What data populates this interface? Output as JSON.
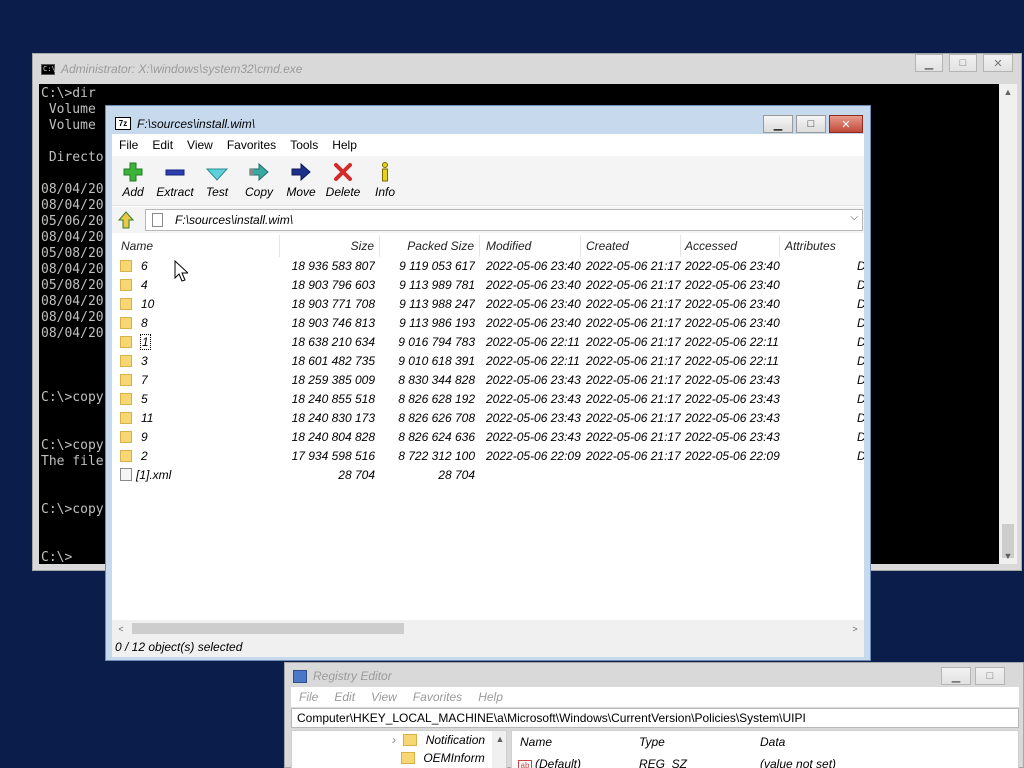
{
  "cmd": {
    "title": "Administrator: X:\\windows\\system32\\cmd.exe",
    "icon": "C:\\",
    "lines": [
      "C:\\>dir",
      " Volume",
      " Volume",
      "",
      " Directo",
      "",
      "08/04/20",
      "08/04/20",
      "05/06/20",
      "08/04/20",
      "05/08/20",
      "08/04/20",
      "05/08/20",
      "08/04/20",
      "08/04/20",
      "08/04/20",
      "",
      "",
      "",
      "C:\\>copy",
      "",
      "",
      "C:\\>copy",
      "The file",
      "",
      "",
      "C:\\>copy",
      "",
      "",
      "C:\\>"
    ]
  },
  "zip": {
    "title": "F:\\sources\\install.wim\\",
    "icon": "7z",
    "menu": [
      "File",
      "Edit",
      "View",
      "Favorites",
      "Tools",
      "Help"
    ],
    "toolbar": [
      {
        "label": "Add",
        "icon": "add-icon"
      },
      {
        "label": "Extract",
        "icon": "extract-icon"
      },
      {
        "label": "Test",
        "icon": "test-icon"
      },
      {
        "label": "Copy",
        "icon": "copy-icon"
      },
      {
        "label": "Move",
        "icon": "move-icon"
      },
      {
        "label": "Delete",
        "icon": "delete-icon"
      },
      {
        "label": "Info",
        "icon": "info-icon"
      }
    ],
    "address": "F:\\sources\\install.wim\\",
    "columns": [
      "Name",
      "Size",
      "Packed Size",
      "Modified",
      "Created",
      "Accessed",
      "Attributes"
    ],
    "rows": [
      {
        "name": "6",
        "size": "18 936 583 807",
        "packed": "9 119 053 617",
        "modified": "2022-05-06 23:40",
        "created": "2022-05-06 21:17",
        "accessed": "2022-05-06 23:40",
        "attr": "D",
        "type": "folder"
      },
      {
        "name": "4",
        "size": "18 903 796 603",
        "packed": "9 113 989 781",
        "modified": "2022-05-06 23:40",
        "created": "2022-05-06 21:17",
        "accessed": "2022-05-06 23:40",
        "attr": "D",
        "type": "folder"
      },
      {
        "name": "10",
        "size": "18 903 771 708",
        "packed": "9 113 988 247",
        "modified": "2022-05-06 23:40",
        "created": "2022-05-06 21:17",
        "accessed": "2022-05-06 23:40",
        "attr": "D",
        "type": "folder"
      },
      {
        "name": "8",
        "size": "18 903 746 813",
        "packed": "9 113 986 193",
        "modified": "2022-05-06 23:40",
        "created": "2022-05-06 21:17",
        "accessed": "2022-05-06 23:40",
        "attr": "D",
        "type": "folder"
      },
      {
        "name": "1",
        "size": "18 638 210 634",
        "packed": "9 016 794 783",
        "modified": "2022-05-06 22:11",
        "created": "2022-05-06 21:17",
        "accessed": "2022-05-06 22:11",
        "attr": "D",
        "type": "folder"
      },
      {
        "name": "3",
        "size": "18 601 482 735",
        "packed": "9 010 618 391",
        "modified": "2022-05-06 22:11",
        "created": "2022-05-06 21:17",
        "accessed": "2022-05-06 22:11",
        "attr": "D",
        "type": "folder"
      },
      {
        "name": "7",
        "size": "18 259 385 009",
        "packed": "8 830 344 828",
        "modified": "2022-05-06 23:43",
        "created": "2022-05-06 21:17",
        "accessed": "2022-05-06 23:43",
        "attr": "D",
        "type": "folder"
      },
      {
        "name": "5",
        "size": "18 240 855 518",
        "packed": "8 826 628 192",
        "modified": "2022-05-06 23:43",
        "created": "2022-05-06 21:17",
        "accessed": "2022-05-06 23:43",
        "attr": "D",
        "type": "folder"
      },
      {
        "name": "11",
        "size": "18 240 830 173",
        "packed": "8 826 626 708",
        "modified": "2022-05-06 23:43",
        "created": "2022-05-06 21:17",
        "accessed": "2022-05-06 23:43",
        "attr": "D",
        "type": "folder"
      },
      {
        "name": "9",
        "size": "18 240 804 828",
        "packed": "8 826 624 636",
        "modified": "2022-05-06 23:43",
        "created": "2022-05-06 21:17",
        "accessed": "2022-05-06 23:43",
        "attr": "D",
        "type": "folder"
      },
      {
        "name": "2",
        "size": "17 934 598 516",
        "packed": "8 722 312 100",
        "modified": "2022-05-06 22:09",
        "created": "2022-05-06 21:17",
        "accessed": "2022-05-06 22:09",
        "attr": "D",
        "type": "folder"
      },
      {
        "name": "[1].xml",
        "size": "28 704",
        "packed": "28 704",
        "modified": "",
        "created": "",
        "accessed": "",
        "attr": "",
        "type": "file"
      }
    ],
    "status": "0 / 12 object(s) selected"
  },
  "reg": {
    "title": "Registry Editor",
    "menu": [
      "File",
      "Edit",
      "View",
      "Favorites",
      "Help"
    ],
    "address": "Computer\\HKEY_LOCAL_MACHINE\\a\\Microsoft\\Windows\\CurrentVersion\\Policies\\System\\UIPI",
    "tree": [
      "Notification",
      "OEMInform"
    ],
    "columns": [
      "Name",
      "Type",
      "Data"
    ],
    "value": {
      "name": "(Default)",
      "type": "REG_SZ",
      "data": "(value not set)"
    }
  }
}
